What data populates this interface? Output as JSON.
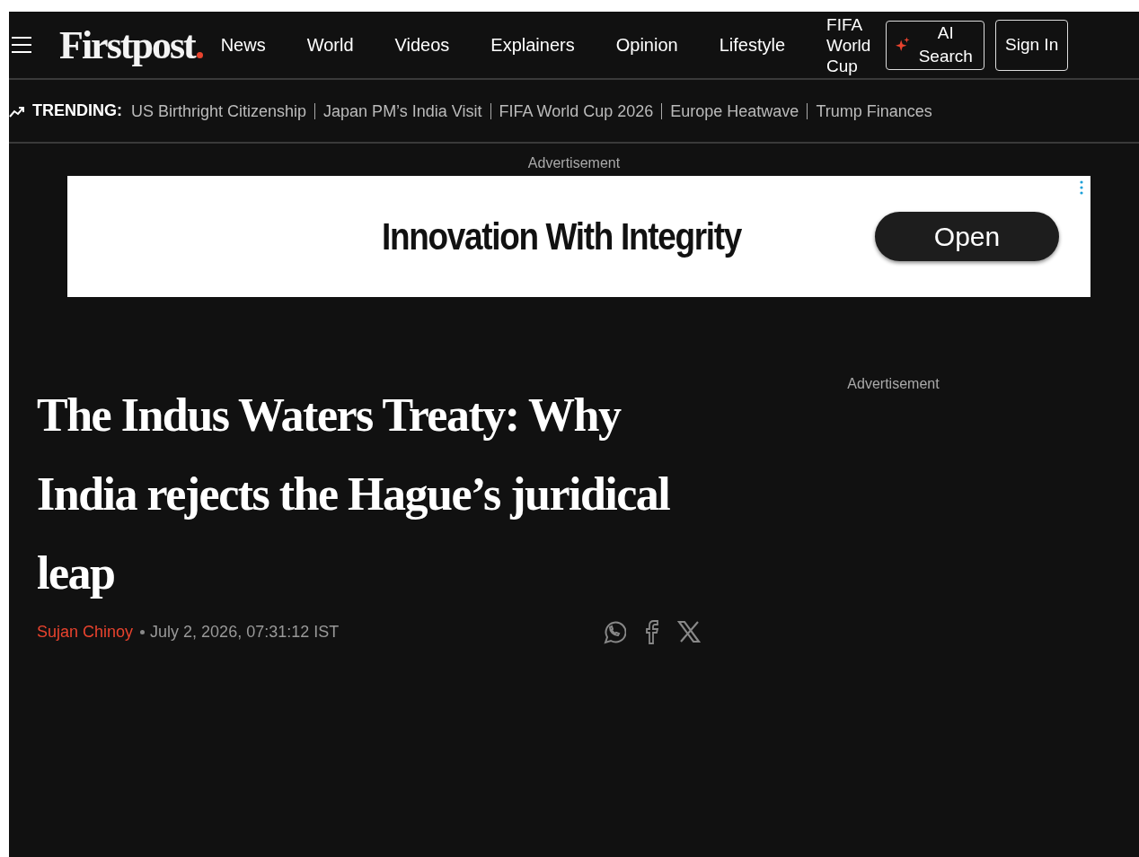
{
  "header": {
    "logo": "Firstpost",
    "nav": [
      "News",
      "World",
      "Videos",
      "Explainers",
      "Opinion",
      "Lifestyle",
      "FIFA World Cup"
    ],
    "ai_search": "AI Search",
    "sign_in": "Sign In"
  },
  "trending": {
    "label": "TRENDING:",
    "items": [
      "US Birthright Citizenship",
      "Japan PM’s India Visit",
      "FIFA World Cup 2026",
      "Europe Heatwave",
      "Trump Finances"
    ]
  },
  "ad_label": "Advertisement",
  "ad": {
    "headline": "Innovation With Integrity",
    "button": "Open"
  },
  "side_ad_label": "Advertisement",
  "article": {
    "title": "The Indus Waters Treaty: Why India rejects the Hague’s juridical leap",
    "author": "Sujan Chinoy",
    "date": "July 2, 2026, 07:31:12 IST"
  }
}
